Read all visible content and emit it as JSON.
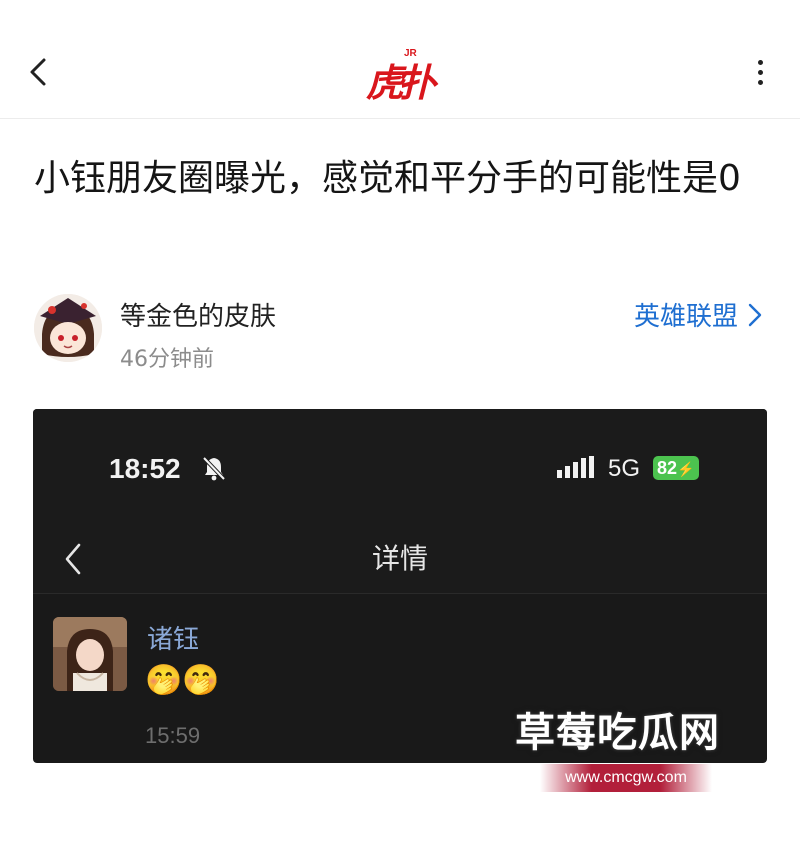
{
  "header": {
    "logo_badge": "JR",
    "logo_text": "虎扑",
    "back_icon": "chevron-left-icon",
    "more_icon": "more-vertical-icon"
  },
  "post": {
    "title": "小钰朋友圈曝光，感觉和平分手的可能性是0",
    "author": "等金色的皮肤",
    "time": "46分钟前",
    "board": "英雄联盟",
    "link_color": "#1f6fd1"
  },
  "screenshot": {
    "status_time": "18:52",
    "network": "5G",
    "battery": "82",
    "nav_title": "详情",
    "msg_name": "诸钰",
    "msg_emoji": "🤭🤭",
    "msg_time": "15:59"
  },
  "watermark": {
    "text": "草莓吃瓜网",
    "url": "www.cmcgw.com"
  }
}
